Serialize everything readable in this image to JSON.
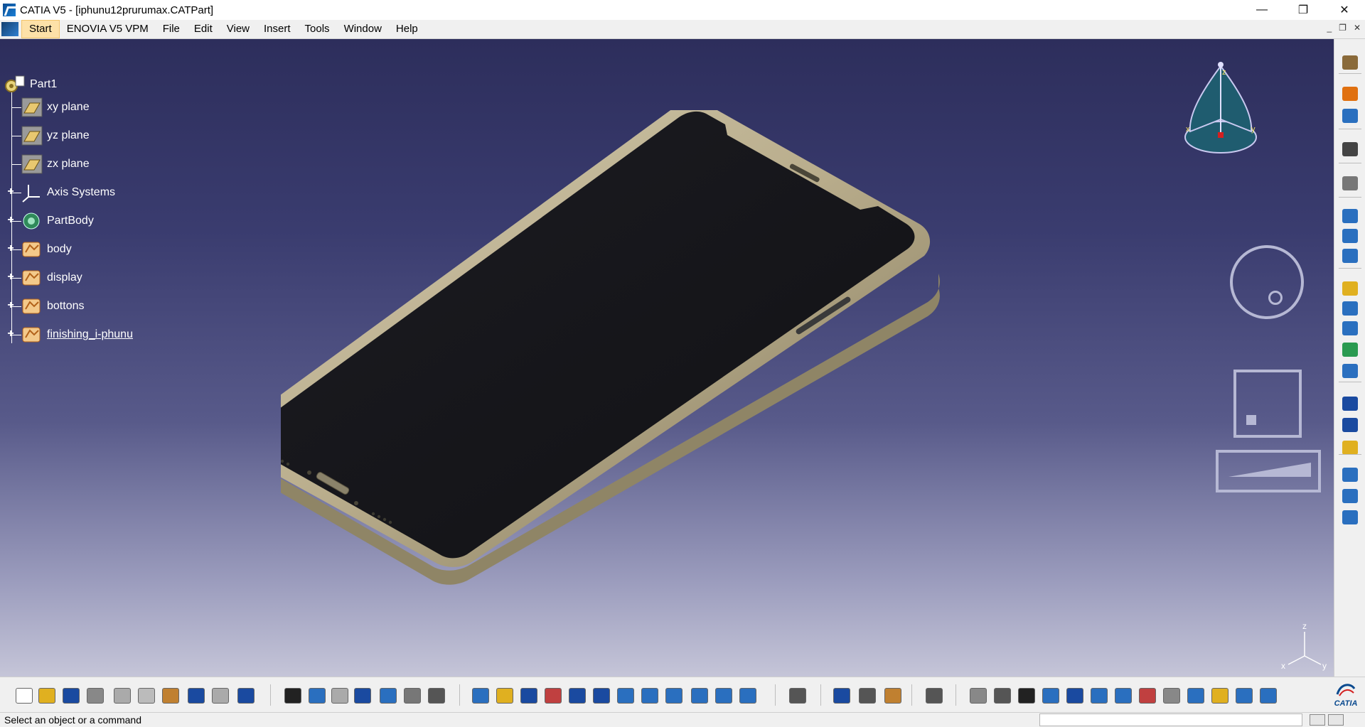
{
  "window": {
    "title": "CATIA V5 - [iphunu12prurumax.CATPart]",
    "minimize": "—",
    "restore": "❐",
    "close": "✕"
  },
  "menu": {
    "items": [
      "Start",
      "ENOVIA V5 VPM",
      "File",
      "Edit",
      "View",
      "Insert",
      "Tools",
      "Window",
      "Help"
    ]
  },
  "tree": {
    "root": "Part1",
    "items": [
      {
        "label": "xy plane",
        "icon": "plane-icon",
        "expandable": false
      },
      {
        "label": "yz plane",
        "icon": "plane-icon",
        "expandable": false
      },
      {
        "label": "zx plane",
        "icon": "plane-icon",
        "expandable": false
      },
      {
        "label": "Axis Systems",
        "icon": "axis-system-icon",
        "expandable": true
      },
      {
        "label": "PartBody",
        "icon": "partbody-icon",
        "expandable": true
      },
      {
        "label": "body",
        "icon": "geometrical-set-icon",
        "expandable": true
      },
      {
        "label": "display",
        "icon": "geometrical-set-icon",
        "expandable": true
      },
      {
        "label": "bottons",
        "icon": "geometrical-set-icon",
        "expandable": true
      },
      {
        "label": "finishing_i-phunu",
        "icon": "geometrical-set-icon",
        "expandable": true,
        "selected": true
      }
    ]
  },
  "compass": {
    "x": "x",
    "y": "y",
    "z": "z"
  },
  "mini_axis": {
    "x": "x",
    "y": "y",
    "z": "z"
  },
  "status": {
    "message": "Select an object or a command"
  },
  "colors": {
    "viewport_top": "#2d2e5c",
    "viewport_bottom": "#c5c5d8",
    "phone_frame": "#b7ab8a",
    "phone_screen": "#15151a"
  },
  "logo": {
    "brand": "CATIA"
  }
}
